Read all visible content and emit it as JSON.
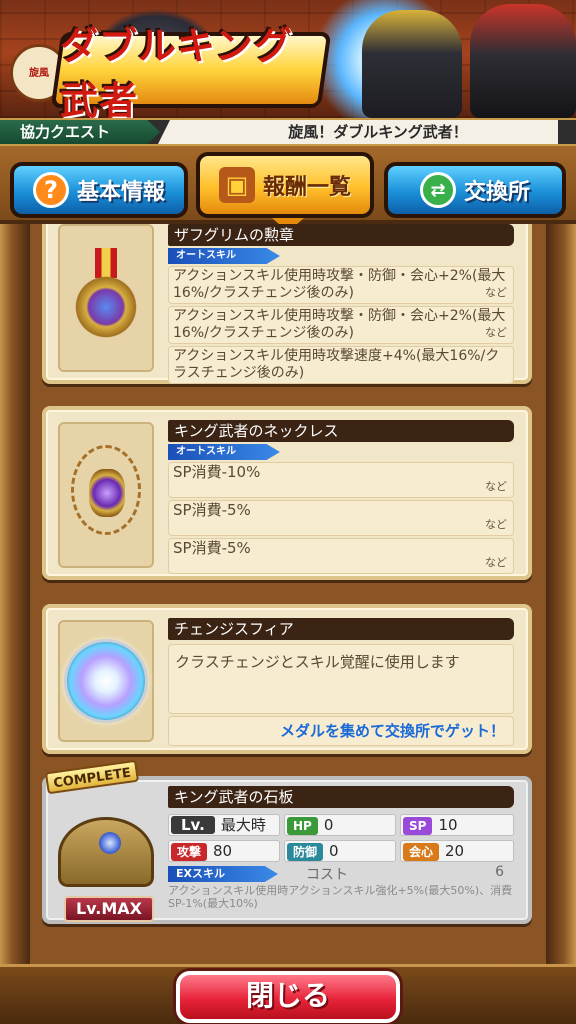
{
  "banner": {
    "title": "ダブルキング武者",
    "seal": "旋風"
  },
  "infobar": {
    "category": "協力クエスト",
    "quest_name": "旋風！ダブルキング武者！"
  },
  "tabs": [
    {
      "label": "基本情報",
      "icon": "question-icon",
      "selected": false
    },
    {
      "label": "報酬一覧",
      "icon": "treasure-chest-icon",
      "selected": true
    },
    {
      "label": "交換所",
      "icon": "exchange-icon",
      "selected": false
    }
  ],
  "rewards": [
    {
      "name": "ザフグリムの勲章",
      "skill_tag": "オートスキル",
      "icon": "medal-icon",
      "rows": [
        {
          "text": "アクションスキル使用時攻撃・防御・会心+2%(最大16%/クラスチェンジ後のみ)",
          "suffix": "など"
        },
        {
          "text": "アクションスキル使用時攻撃・防御・会心+2%(最大16%/クラスチェンジ後のみ)",
          "suffix": "など"
        },
        {
          "text": "アクションスキル使用時攻撃速度+4%(最大16%/クラスチェンジ後のみ)",
          "suffix": ""
        }
      ]
    },
    {
      "name": "キング武者のネックレス",
      "skill_tag": "オートスキル",
      "icon": "necklace-icon",
      "rows": [
        {
          "text": "SP消費-10%",
          "suffix": "など"
        },
        {
          "text": "SP消費-5%",
          "suffix": "など"
        },
        {
          "text": "SP消費-5%",
          "suffix": "など"
        }
      ]
    },
    {
      "name": "チェンジスフィア",
      "icon": "sphere-icon",
      "description": "クラスチェンジとスキル覚醒に使用します",
      "hint": "メダルを集めて交換所でゲット！"
    }
  ],
  "slab": {
    "badge": "COMPLETE",
    "name": "キング武者の石板",
    "lv_button": "Lv.MAX",
    "lv_label": "Lv.",
    "lv_value": "最大時",
    "stats": {
      "hp_label": "HP",
      "hp": "0",
      "sp_label": "SP",
      "sp": "10",
      "atk_label": "攻撃",
      "atk": "80",
      "def_label": "防御",
      "def": "0",
      "crit_label": "会心",
      "crit": "20"
    },
    "ex_tag": "EXスキル",
    "cost_label": "コスト",
    "cost": "6",
    "ex_desc": "アクションスキル使用時アクションスキル強化+5%(最大50%)、消費SP-1%(最大10%)"
  },
  "footer": {
    "close_label": "閉じる"
  }
}
